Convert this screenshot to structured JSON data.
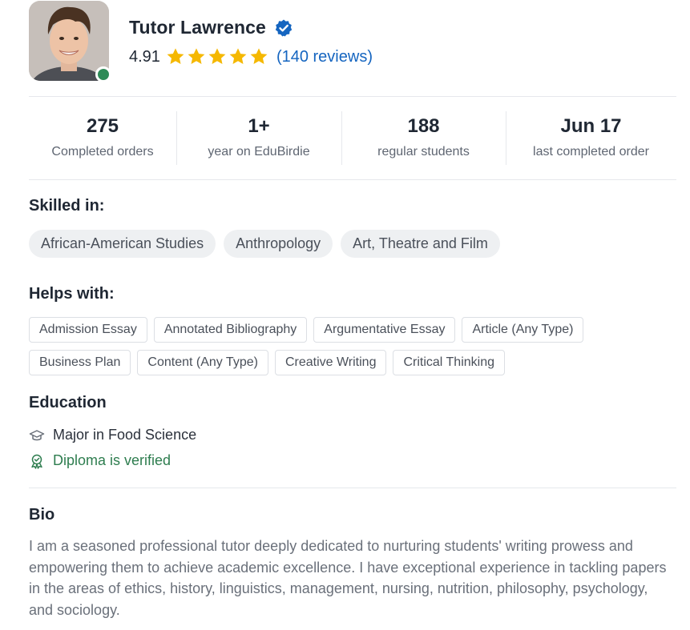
{
  "profile": {
    "name": "Tutor Lawrence",
    "rating": "4.91",
    "reviews": "(140 reviews)",
    "online": true,
    "stars": 5
  },
  "stats": [
    {
      "value": "275",
      "label": "Completed orders"
    },
    {
      "value": "1+",
      "label": "year on EduBirdie"
    },
    {
      "value": "188",
      "label": "regular students"
    },
    {
      "value": "Jun 17",
      "label": "last completed order"
    }
  ],
  "skills": {
    "title": "Skilled in:",
    "items": [
      "African-American Studies",
      "Anthropology",
      "Art, Theatre and Film"
    ]
  },
  "helps": {
    "title": "Helps with:",
    "items": [
      "Admission Essay",
      "Annotated Bibliography",
      "Argumentative Essay",
      "Article (Any Type)",
      "Business Plan",
      "Content (Any Type)",
      "Creative Writing",
      "Critical Thinking"
    ]
  },
  "education": {
    "title": "Education",
    "major": "Major in Food Science",
    "major_icon": "graduation-cap-icon",
    "verified": "Diploma is verified",
    "verified_icon": "award-badge-icon"
  },
  "bio": {
    "title": "Bio",
    "text": "I am a seasoned professional tutor deeply dedicated to nurturing students' writing prowess and empowering them to achieve academic excellence. I have exceptional experience in tackling papers in the areas of ethics, history, linguistics, management, nursing, nutrition, philosophy, psychology, and sociology."
  },
  "colors": {
    "star": "#f5b800",
    "verified_badge": "#1565c0",
    "online": "#2e8b57",
    "link": "#1565c0",
    "success": "#2e7d4f"
  }
}
